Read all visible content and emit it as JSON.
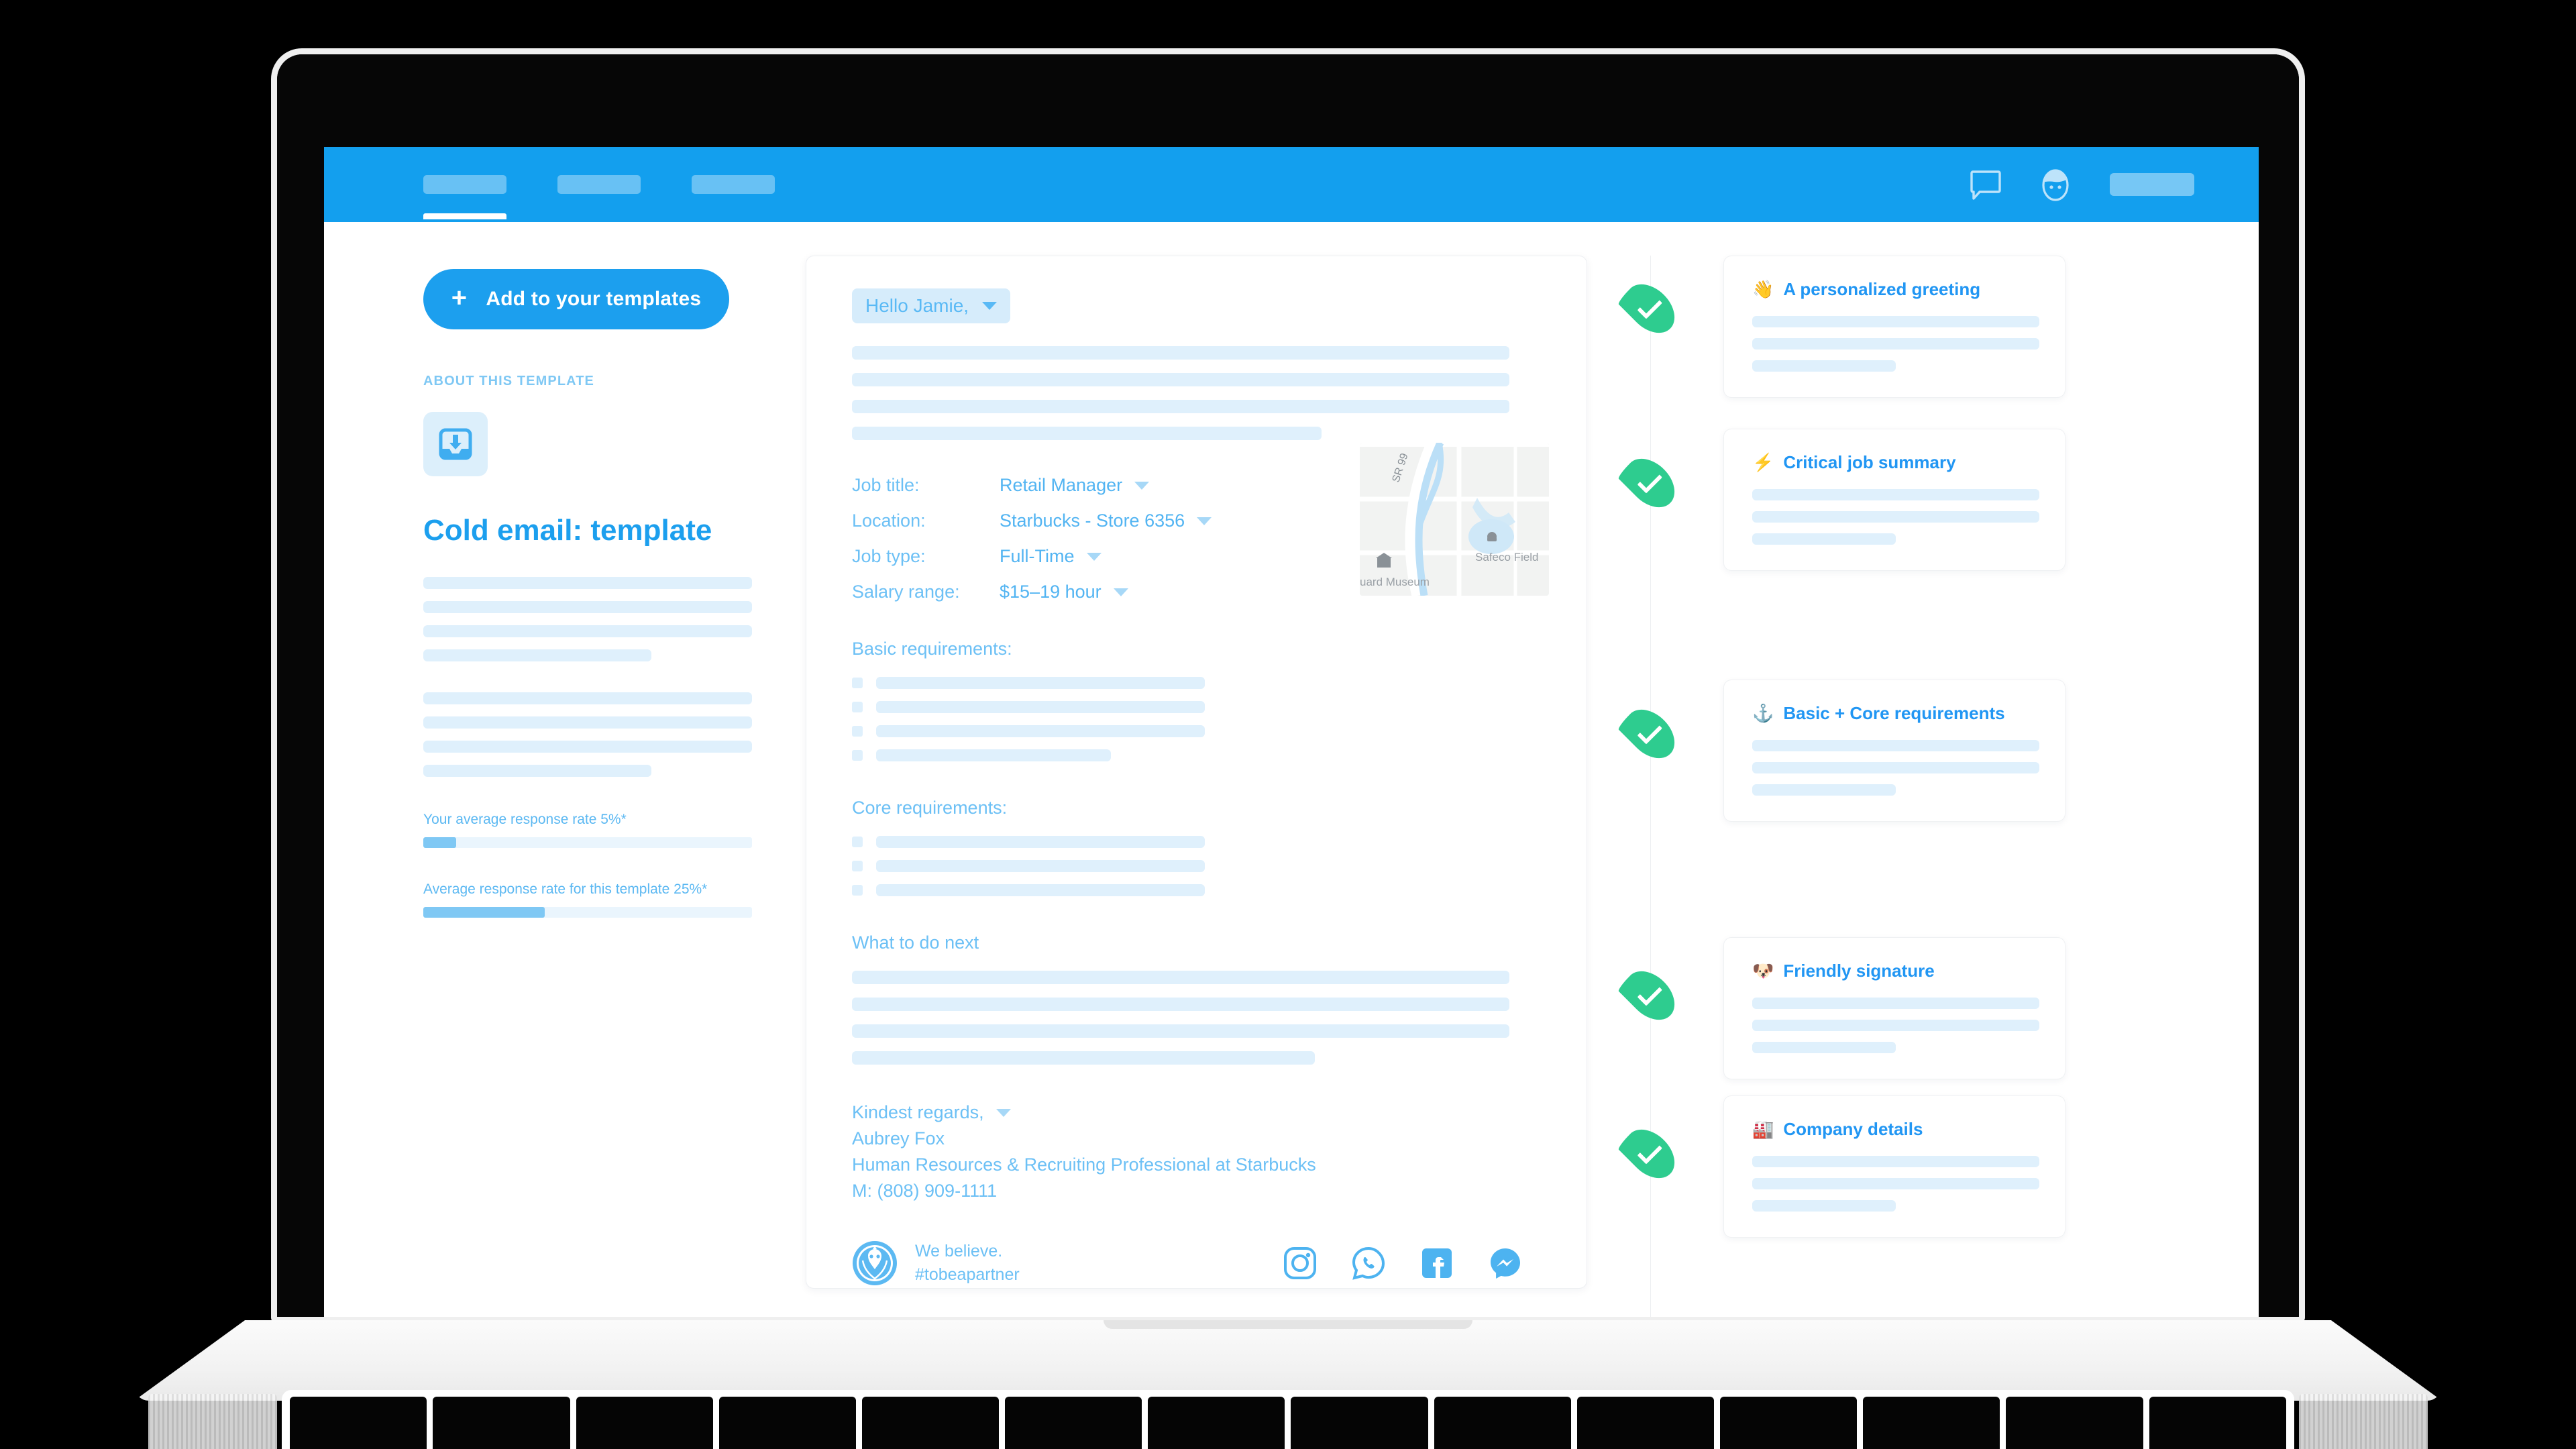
{
  "nav": {
    "tabs": [
      {
        "name": "tab-1",
        "label": ""
      },
      {
        "name": "tab-2",
        "label": ""
      },
      {
        "name": "tab-3",
        "label": ""
      }
    ],
    "chat_icon": "chat-bubble-icon",
    "avatar_icon": "user-avatar-icon",
    "user_name": "",
    "bg_color": "#139FEE"
  },
  "sidebar": {
    "add_button_label": "Add to your templates",
    "add_button_icon": "plus-icon",
    "section_label": "ABOUT THIS TEMPLATE",
    "template_icon": "template-download-icon",
    "template_title": "Cold email: template",
    "stats": [
      {
        "label": "Your average response rate 5%*",
        "value": 5,
        "fill_pct": 10
      },
      {
        "label": "Average response rate for this template 25%*",
        "value": 25,
        "fill_pct": 37
      }
    ]
  },
  "email": {
    "greeting": "Hello Jamie,",
    "greeting_caret": "chevron-down-icon",
    "fields": [
      {
        "label": "Job title:",
        "value": "Retail Manager"
      },
      {
        "label": "Location:",
        "value": "Starbucks - Store 6356"
      },
      {
        "label": "Job type:",
        "value": "Full-Time"
      },
      {
        "label": "Salary range:",
        "value": "$15–19 hour"
      }
    ],
    "map": {
      "road_label": "SR 99",
      "stadium_label": "Safeco Field",
      "museum_label": "uard Museum"
    },
    "sections": [
      {
        "title": "Basic requirements:",
        "bullet_count": 4
      },
      {
        "title": "Core requirements:",
        "bullet_count": 3
      },
      {
        "title": "What to do next",
        "bullet_count": 0
      }
    ],
    "signoff": {
      "closing": "Kindest regards,",
      "name": "Aubrey Fox",
      "role": "Human Resources & Recruiting Professional at Starbucks",
      "phone": "M: (808) 909-1111"
    },
    "footer": {
      "logo": "starbucks-logo-icon",
      "tagline_line1": "We believe.",
      "tagline_line2": "#tobeapartner",
      "socials": [
        {
          "name": "instagram-icon"
        },
        {
          "name": "whatsapp-icon"
        },
        {
          "name": "facebook-icon"
        },
        {
          "name": "messenger-icon"
        }
      ]
    }
  },
  "annotations": {
    "check_color": "#2ECC8F",
    "cards": [
      {
        "emoji": "👋",
        "title": "A personalized greeting"
      },
      {
        "emoji": "⚡",
        "title": "Critical job summary"
      },
      {
        "emoji": "⚓",
        "title": "Basic + Core requirements"
      },
      {
        "emoji": "🐶",
        "title": "Friendly signature"
      },
      {
        "emoji": "🏭",
        "title": "Company details"
      }
    ]
  }
}
